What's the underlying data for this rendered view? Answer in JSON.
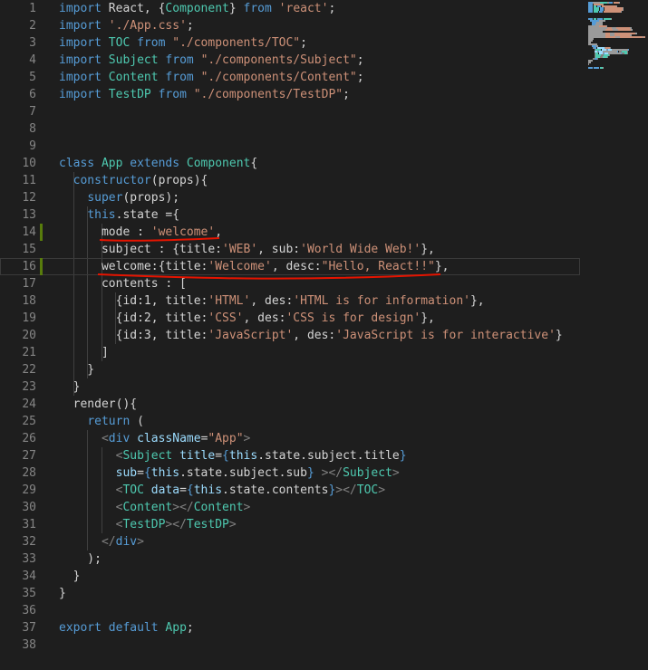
{
  "editor": {
    "lines": [
      {
        "n": "1",
        "tokens": [
          [
            "kw",
            "import"
          ],
          [
            "pl",
            " React, {"
          ],
          [
            "ty",
            "Component"
          ],
          [
            "pl",
            "} "
          ],
          [
            "kw",
            "from"
          ],
          [
            "pl",
            " "
          ],
          [
            "st",
            "'react'"
          ],
          [
            "pl",
            ";"
          ]
        ]
      },
      {
        "n": "2",
        "tokens": [
          [
            "kw",
            "import"
          ],
          [
            "pl",
            " "
          ],
          [
            "st",
            "'./App.css'"
          ],
          [
            "pl",
            ";"
          ]
        ]
      },
      {
        "n": "3",
        "tokens": [
          [
            "kw",
            "import"
          ],
          [
            "pl",
            " "
          ],
          [
            "ty",
            "TOC"
          ],
          [
            "pl",
            " "
          ],
          [
            "kw",
            "from"
          ],
          [
            "pl",
            " "
          ],
          [
            "st",
            "\"./components/TOC\""
          ],
          [
            "pl",
            ";"
          ]
        ]
      },
      {
        "n": "4",
        "tokens": [
          [
            "kw",
            "import"
          ],
          [
            "pl",
            " "
          ],
          [
            "ty",
            "Subject"
          ],
          [
            "pl",
            " "
          ],
          [
            "kw",
            "from"
          ],
          [
            "pl",
            " "
          ],
          [
            "st",
            "\"./components/Subject\""
          ],
          [
            "pl",
            ";"
          ]
        ]
      },
      {
        "n": "5",
        "tokens": [
          [
            "kw",
            "import"
          ],
          [
            "pl",
            " "
          ],
          [
            "ty",
            "Content"
          ],
          [
            "pl",
            " "
          ],
          [
            "kw",
            "from"
          ],
          [
            "pl",
            " "
          ],
          [
            "st",
            "\"./components/Content\""
          ],
          [
            "pl",
            ";"
          ]
        ]
      },
      {
        "n": "6",
        "tokens": [
          [
            "kw",
            "import"
          ],
          [
            "pl",
            " "
          ],
          [
            "ty",
            "TestDP"
          ],
          [
            "pl",
            " "
          ],
          [
            "kw",
            "from"
          ],
          [
            "pl",
            " "
          ],
          [
            "st",
            "\"./components/TestDP\""
          ],
          [
            "pl",
            ";"
          ]
        ]
      },
      {
        "n": "7",
        "tokens": []
      },
      {
        "n": "8",
        "tokens": []
      },
      {
        "n": "9",
        "tokens": []
      },
      {
        "n": "10",
        "tokens": [
          [
            "kw",
            "class"
          ],
          [
            "pl",
            " "
          ],
          [
            "ty",
            "App"
          ],
          [
            "pl",
            " "
          ],
          [
            "kw",
            "extends"
          ],
          [
            "pl",
            " "
          ],
          [
            "ty",
            "Component"
          ],
          [
            "pl",
            "{"
          ]
        ]
      },
      {
        "n": "11",
        "tokens": [
          [
            "pl",
            "  "
          ],
          [
            "kw",
            "constructor"
          ],
          [
            "pl",
            "(props){"
          ]
        ]
      },
      {
        "n": "12",
        "tokens": [
          [
            "pl",
            "    "
          ],
          [
            "kw",
            "super"
          ],
          [
            "pl",
            "(props);"
          ]
        ]
      },
      {
        "n": "13",
        "tokens": [
          [
            "pl",
            "    "
          ],
          [
            "kw",
            "this"
          ],
          [
            "pl",
            ".state ={"
          ]
        ]
      },
      {
        "n": "14",
        "tokens": [
          [
            "pl",
            "      mode : "
          ],
          [
            "st",
            "'welcome'"
          ],
          [
            "pl",
            ","
          ]
        ]
      },
      {
        "n": "15",
        "tokens": [
          [
            "pl",
            "      subject : {title:"
          ],
          [
            "st",
            "'WEB'"
          ],
          [
            "pl",
            ", sub:"
          ],
          [
            "st",
            "'World Wide Web!'"
          ],
          [
            "pl",
            "},"
          ]
        ]
      },
      {
        "n": "16",
        "tokens": [
          [
            "pl",
            "      welcome:{title:"
          ],
          [
            "st",
            "'Welcome'"
          ],
          [
            "pl",
            ", desc:"
          ],
          [
            "st",
            "\"Hello, React!!\""
          ],
          [
            "pl",
            "},"
          ]
        ]
      },
      {
        "n": "17",
        "tokens": [
          [
            "pl",
            "      contents : ["
          ]
        ]
      },
      {
        "n": "18",
        "tokens": [
          [
            "pl",
            "        {id:1, title:"
          ],
          [
            "st",
            "'HTML'"
          ],
          [
            "pl",
            ", des:"
          ],
          [
            "st",
            "'HTML is for information'"
          ],
          [
            "pl",
            "},"
          ]
        ]
      },
      {
        "n": "19",
        "tokens": [
          [
            "pl",
            "        {id:2, title:"
          ],
          [
            "st",
            "'CSS'"
          ],
          [
            "pl",
            ", des:"
          ],
          [
            "st",
            "'CSS is for design'"
          ],
          [
            "pl",
            "},"
          ]
        ]
      },
      {
        "n": "20",
        "tokens": [
          [
            "pl",
            "        {id:3, title:"
          ],
          [
            "st",
            "'JavaScript'"
          ],
          [
            "pl",
            ", des:"
          ],
          [
            "st",
            "'JavaScript is for interactive'"
          ],
          [
            "pl",
            "}"
          ]
        ]
      },
      {
        "n": "21",
        "tokens": [
          [
            "pl",
            "      ]"
          ]
        ]
      },
      {
        "n": "22",
        "tokens": [
          [
            "pl",
            "    }"
          ]
        ]
      },
      {
        "n": "23",
        "tokens": [
          [
            "pl",
            "  }"
          ]
        ]
      },
      {
        "n": "24",
        "tokens": [
          [
            "pl",
            "  render(){"
          ]
        ]
      },
      {
        "n": "25",
        "tokens": [
          [
            "pl",
            "    "
          ],
          [
            "kw",
            "return"
          ],
          [
            "pl",
            " ("
          ]
        ]
      },
      {
        "n": "26",
        "tokens": [
          [
            "pl",
            "      "
          ],
          [
            "tag",
            "<"
          ],
          [
            "jsx",
            "div"
          ],
          [
            "pl",
            " "
          ],
          [
            "attr",
            "className"
          ],
          [
            "pl",
            "="
          ],
          [
            "st",
            "\"App\""
          ],
          [
            "tag",
            ">"
          ]
        ]
      },
      {
        "n": "27",
        "tokens": [
          [
            "pl",
            "        "
          ],
          [
            "tag",
            "<"
          ],
          [
            "ty",
            "Subject"
          ],
          [
            "pl",
            " "
          ],
          [
            "attr",
            "title"
          ],
          [
            "pl",
            "="
          ],
          [
            "jsx",
            "{"
          ],
          [
            "attr",
            "this"
          ],
          [
            "pl",
            ".state.subject.title"
          ],
          [
            "jsx",
            "}"
          ]
        ]
      },
      {
        "n": "28",
        "tokens": [
          [
            "pl",
            "        "
          ],
          [
            "attr",
            "sub"
          ],
          [
            "pl",
            "="
          ],
          [
            "jsx",
            "{"
          ],
          [
            "attr",
            "this"
          ],
          [
            "pl",
            ".state.subject.sub"
          ],
          [
            "jsx",
            "}"
          ],
          [
            "pl",
            " "
          ],
          [
            "tag",
            "></"
          ],
          [
            "ty",
            "Subject"
          ],
          [
            "tag",
            ">"
          ]
        ]
      },
      {
        "n": "29",
        "tokens": [
          [
            "pl",
            "        "
          ],
          [
            "tag",
            "<"
          ],
          [
            "ty",
            "TOC"
          ],
          [
            "pl",
            " "
          ],
          [
            "attr",
            "data"
          ],
          [
            "pl",
            "="
          ],
          [
            "jsx",
            "{"
          ],
          [
            "attr",
            "this"
          ],
          [
            "pl",
            ".state.contents"
          ],
          [
            "jsx",
            "}"
          ],
          [
            "tag",
            "></"
          ],
          [
            "ty",
            "TOC"
          ],
          [
            "tag",
            ">"
          ]
        ]
      },
      {
        "n": "30",
        "tokens": [
          [
            "pl",
            "        "
          ],
          [
            "tag",
            "<"
          ],
          [
            "ty",
            "Content"
          ],
          [
            "tag",
            "></"
          ],
          [
            "ty",
            "Content"
          ],
          [
            "tag",
            ">"
          ]
        ]
      },
      {
        "n": "31",
        "tokens": [
          [
            "pl",
            "        "
          ],
          [
            "tag",
            "<"
          ],
          [
            "ty",
            "TestDP"
          ],
          [
            "tag",
            "></"
          ],
          [
            "ty",
            "TestDP"
          ],
          [
            "tag",
            ">"
          ]
        ]
      },
      {
        "n": "32",
        "tokens": [
          [
            "pl",
            "      "
          ],
          [
            "tag",
            "</"
          ],
          [
            "jsx",
            "div"
          ],
          [
            "tag",
            ">"
          ]
        ]
      },
      {
        "n": "33",
        "tokens": [
          [
            "pl",
            "    );"
          ]
        ]
      },
      {
        "n": "34",
        "tokens": [
          [
            "pl",
            "  }"
          ]
        ]
      },
      {
        "n": "35",
        "tokens": [
          [
            "pl",
            "}"
          ]
        ]
      },
      {
        "n": "36",
        "tokens": []
      },
      {
        "n": "37",
        "tokens": [
          [
            "kw",
            "export"
          ],
          [
            "pl",
            " "
          ],
          [
            "kw",
            "default"
          ],
          [
            "pl",
            " "
          ],
          [
            "ty",
            "App"
          ],
          [
            "pl",
            ";"
          ]
        ]
      },
      {
        "n": "38",
        "tokens": []
      }
    ],
    "colors": {
      "keyword": "#569cd6",
      "type": "#4ec9b0",
      "string": "#ce9178",
      "plain": "#d4d4d4",
      "line_number": "#858585",
      "background": "#1e1e1e",
      "annotation": "#e51400",
      "modified": "#587c0c"
    },
    "modified_lines": [
      "14",
      "16"
    ],
    "current_line": "16",
    "annotations": [
      "red-underline-mode-welcome",
      "red-underline-welcome-line"
    ]
  }
}
